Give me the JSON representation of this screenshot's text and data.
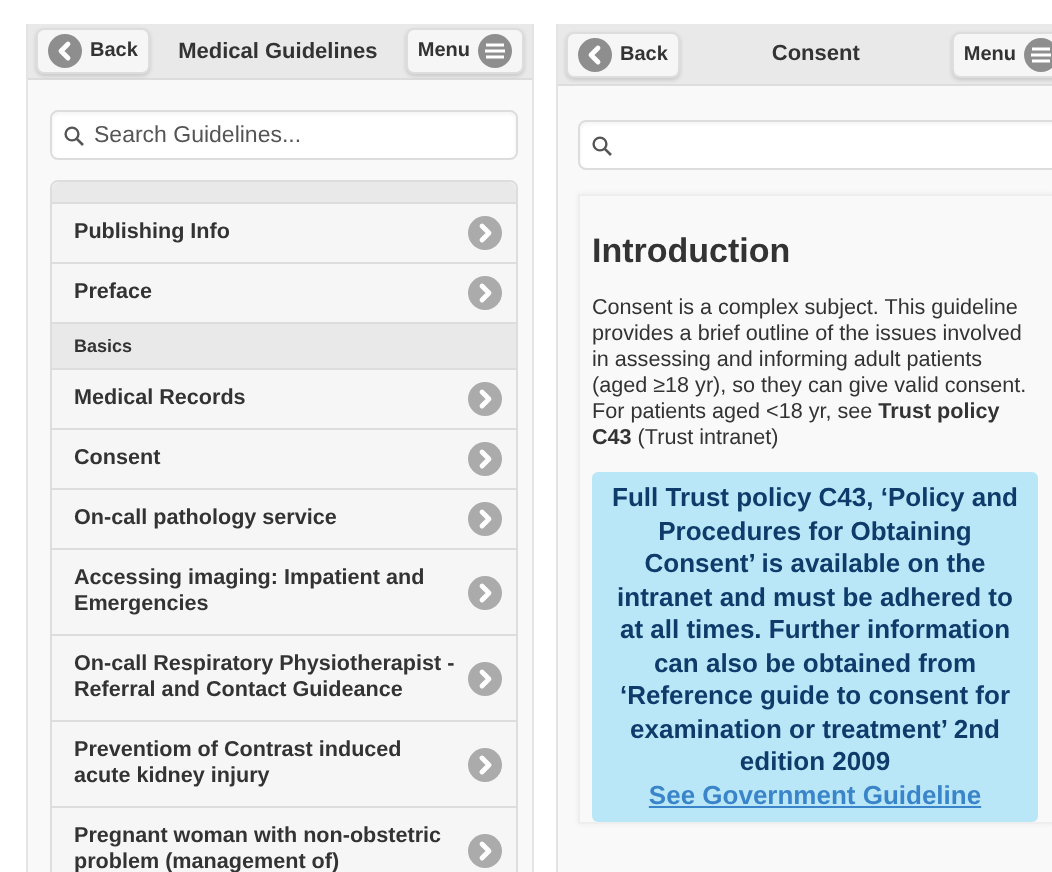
{
  "list_screen": {
    "back_label": "Back",
    "title": "Medical Guidelines",
    "menu_label": "Menu",
    "search": {
      "placeholder": "Search Guidelines..."
    },
    "items": [
      {
        "kind": "item",
        "label": "Publishing Info"
      },
      {
        "kind": "item",
        "label": "Preface"
      },
      {
        "kind": "divider",
        "label": "Basics"
      },
      {
        "kind": "item",
        "label": "Medical Records"
      },
      {
        "kind": "item",
        "label": "Consent"
      },
      {
        "kind": "item",
        "label": "On-call pathology service"
      },
      {
        "kind": "item",
        "label": "Accessing imaging: Impatient and Emergencies"
      },
      {
        "kind": "item",
        "label": "On-call Respiratory Physiotherapist - Referral and Contact Guideance"
      },
      {
        "kind": "item",
        "label": "Preventiom of Contrast induced acute kidney injury"
      },
      {
        "kind": "item",
        "label": "Pregnant woman with non-obstetric problem (management of)"
      }
    ]
  },
  "detail_screen": {
    "back_label": "Back",
    "title": "Consent",
    "menu_label": "Menu",
    "heading": "Introduction",
    "paragraph": "Consent is a complex subject. This guideline provides a brief outline of the issues involved in assessing and informing adult patients (aged ≥18 yr), so they can give valid consent. For patients aged <18 yr, see **Trust policy C43** (Trust intranet)",
    "note": {
      "text": "Full Trust policy C43, ‘Policy and Procedures for Obtaining Consent’ is available on the intranet and must be adhered to at all times. Further information can also be obtained from ‘Reference guide to consent for examination or treatment’ 2nd edition 2009",
      "link": "See Government Guideline"
    }
  }
}
